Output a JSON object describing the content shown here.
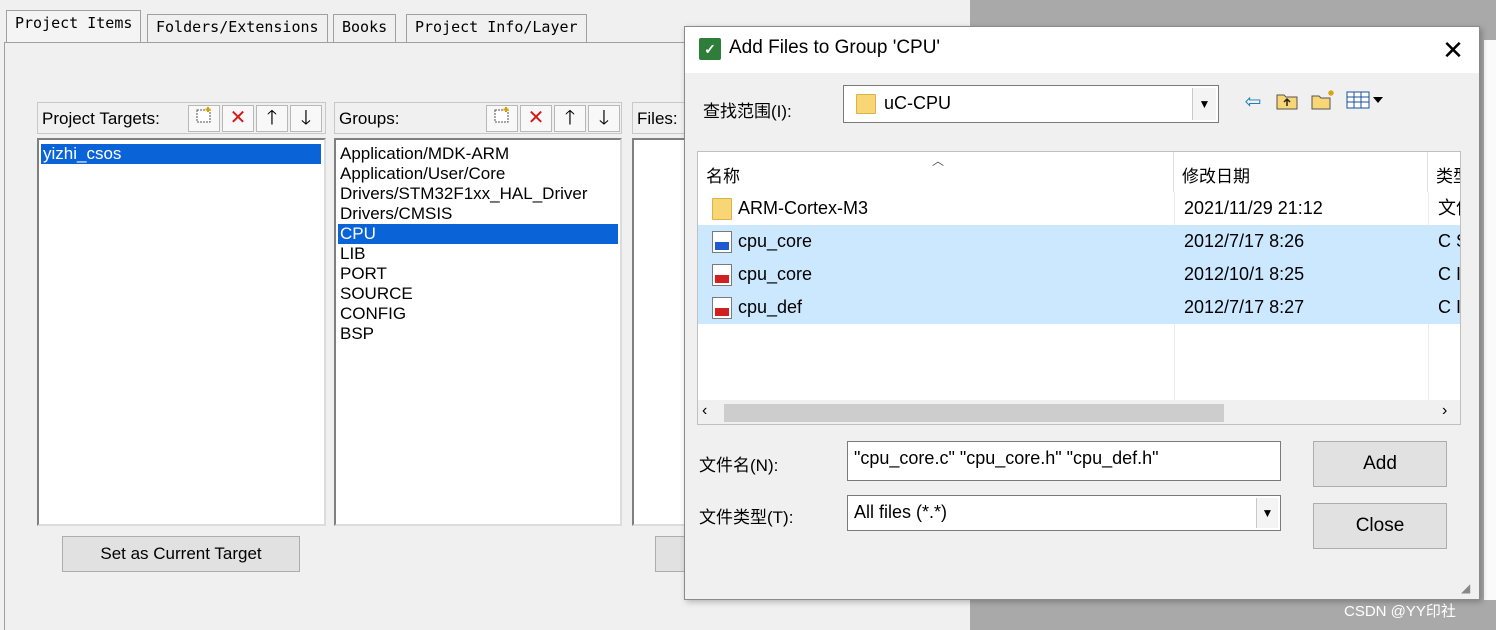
{
  "tabs": [
    "Project Items",
    "Folders/Extensions",
    "Books",
    "Project Info/Layer"
  ],
  "targets": {
    "header": "Project Targets:",
    "items": [
      "yizhi_csos"
    ],
    "set_current_button": "Set as Current Target"
  },
  "groups": {
    "header": "Groups:",
    "items": [
      "Application/MDK-ARM",
      "Application/User/Core",
      "Drivers/STM32F1xx_HAL_Driver",
      "Drivers/CMSIS",
      "CPU",
      "LIB",
      "PORT",
      "SOURCE",
      "CONFIG",
      "BSP"
    ],
    "selected": "CPU"
  },
  "files": {
    "header": "Files:"
  },
  "toolbar_icons": [
    "new-icon",
    "delete-icon",
    "move-up-icon",
    "move-down-icon"
  ],
  "dialog": {
    "title": "Add Files to Group 'CPU'",
    "close_glyph": "✕",
    "look_in_label": "查找范围(I):",
    "look_in_value": "uC-CPU",
    "nav_icons": [
      "back-icon",
      "up-folder-icon",
      "new-folder-icon",
      "view-menu-icon"
    ],
    "columns": [
      "名称",
      "修改日期",
      "类型"
    ],
    "files": [
      {
        "name": "ARM-Cortex-M3",
        "date": "2021/11/29 21:12",
        "type": "文件",
        "icon": "folder-icon",
        "selected": false
      },
      {
        "name": "cpu_core",
        "date": "2012/7/17 8:26",
        "type": "C S",
        "icon": "c-file-icon",
        "selected": true
      },
      {
        "name": "cpu_core",
        "date": "2012/10/1 8:25",
        "type": "C I",
        "icon": "h-file-icon",
        "selected": true
      },
      {
        "name": "cpu_def",
        "date": "2012/7/17 8:27",
        "type": "C I",
        "icon": "h-file-icon",
        "selected": true
      }
    ],
    "filename_label": "文件名(N):",
    "filename_value": "\"cpu_core.c\" \"cpu_core.h\" \"cpu_def.h\"",
    "filetype_label": "文件类型(T):",
    "filetype_value": "All files (*.*)",
    "add_button": "Add",
    "close_button": "Close"
  },
  "watermark": "CSDN @YY印社",
  "colors": {
    "selection": "#0a64d8",
    "row_selected": "#cce8ff"
  }
}
